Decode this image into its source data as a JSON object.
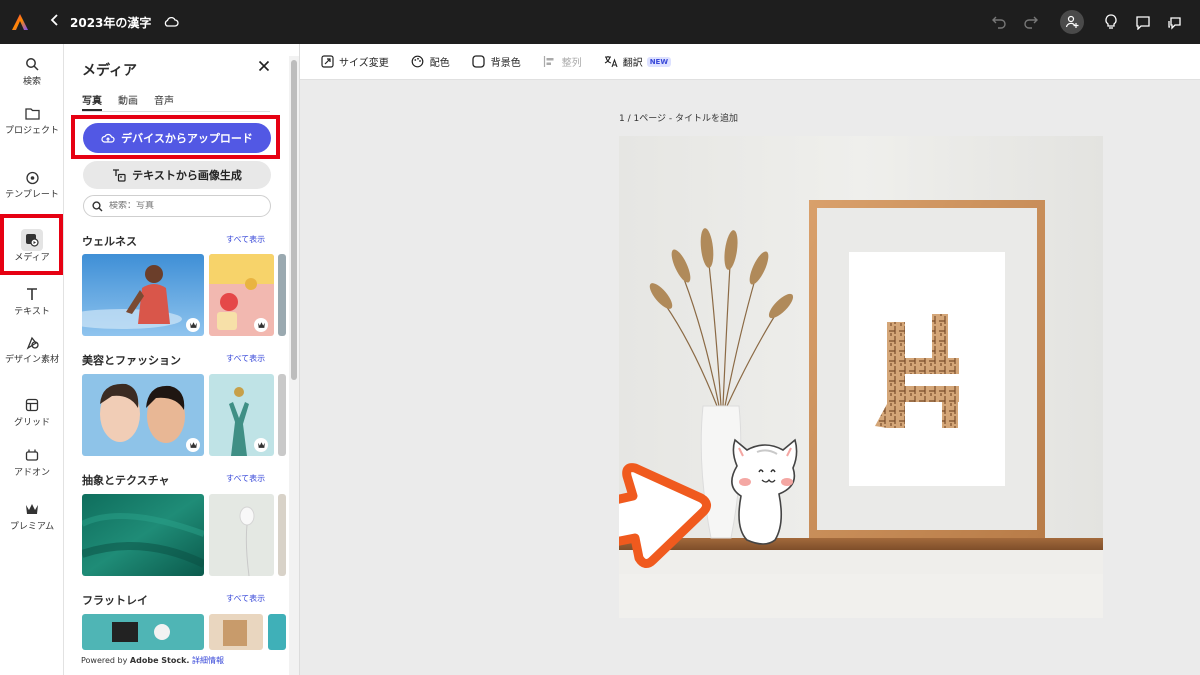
{
  "topbar": {
    "title": "2023年の漢字",
    "back_icon": "chevron-left-icon",
    "icons": [
      "undo-icon",
      "redo-icon",
      "add-user-icon",
      "lightbulb-icon",
      "comment-icon",
      "share-icon"
    ]
  },
  "rail": {
    "items": [
      {
        "label": "検索",
        "icon": "search-icon"
      },
      {
        "label": "プロジェクト",
        "icon": "folder-icon"
      },
      {
        "label": "テンプレート",
        "icon": "template-icon"
      },
      {
        "label": "メディア",
        "icon": "media-icon"
      },
      {
        "label": "テキスト",
        "icon": "text-icon"
      },
      {
        "label": "デザイン素材",
        "icon": "design-assets-icon"
      },
      {
        "label": "グリッド",
        "icon": "grid-icon"
      },
      {
        "label": "アドオン",
        "icon": "addon-icon"
      },
      {
        "label": "プレミアム",
        "icon": "premium-crown-icon"
      }
    ],
    "active": "メディア"
  },
  "panel": {
    "title": "メディア",
    "tabs": [
      "写真",
      "動画",
      "音声"
    ],
    "active_tab": "写真",
    "upload_label": "デバイスからアップロード",
    "generate_label": "テキストから画像生成",
    "search_placeholder": "検索：写真",
    "see_all": "すべて表示",
    "sections": [
      "ウェルネス",
      "美容とファッション",
      "抽象とテクスチャ",
      "フラットレイ"
    ],
    "footer_prefix": "Powered by",
    "footer_brand": "Adobe Stock.",
    "footer_link": "詳細情報"
  },
  "toolbar": {
    "resize": "サイズ変更",
    "color": "配色",
    "background": "背景色",
    "arrange": "整列",
    "translate": "翻訳",
    "new_badge": "NEW"
  },
  "canvas": {
    "page_label": "1 / 1ページ - タイトルを追加",
    "artwork_text": "片"
  },
  "colors": {
    "topbar": "#1e1e1e",
    "accent": "#5258e4",
    "highlight": "#e60012",
    "arrow": "#f05a1e"
  }
}
